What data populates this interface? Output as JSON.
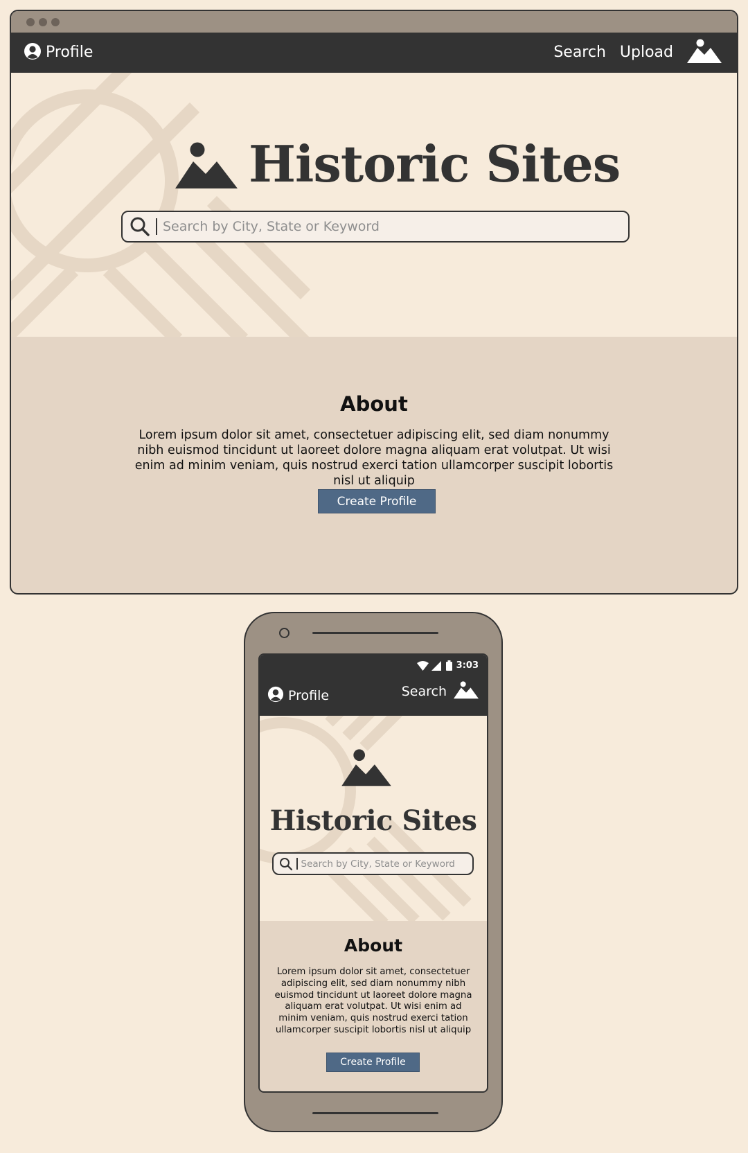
{
  "desktop": {
    "nav": {
      "profile_label": "Profile",
      "search_label": "Search",
      "upload_label": "Upload"
    },
    "hero": {
      "title": "Historic Sites",
      "search_placeholder": "Search by City, State or Keyword"
    },
    "about": {
      "title": "About",
      "text": "Lorem ipsum dolor sit amet, consectetuer adipiscing elit, sed diam nonummy nibh euismod tincidunt ut laoreet dolore magna aliquam erat volutpat. Ut wisi enim ad minim veniam, quis nostrud exerci tation ullamcorper suscipit lobortis nisl ut aliquip",
      "button_label": "Create Profile"
    }
  },
  "mobile": {
    "status": {
      "time": "3:03"
    },
    "nav": {
      "profile_label": "Profile",
      "search_label": "Search"
    },
    "hero": {
      "title": "Historic Sites",
      "search_placeholder": "Search by City, State or Keyword"
    },
    "about": {
      "title": "About",
      "text": "Lorem ipsum dolor sit amet, consectetuer adipiscing elit, sed diam nonummy nibh euismod tincidunt ut laoreet dolore magna aliquam erat volutpat. Ut wisi enim ad minim veniam, quis nostrud exerci tation ullamcorper suscipit lobortis nisl ut aliquip",
      "button_label": "Create Profile"
    }
  },
  "colors": {
    "background": "#f7ebdb",
    "navbar": "#333333",
    "about_bg": "#e4d5c5",
    "button": "#4f6986",
    "frame": "#9d9184",
    "decor": "#e6d7c5"
  },
  "icons": [
    "profile-icon",
    "mountain-logo-icon",
    "search-icon",
    "wifi-icon",
    "signal-icon",
    "battery-icon",
    "camera-icon"
  ]
}
